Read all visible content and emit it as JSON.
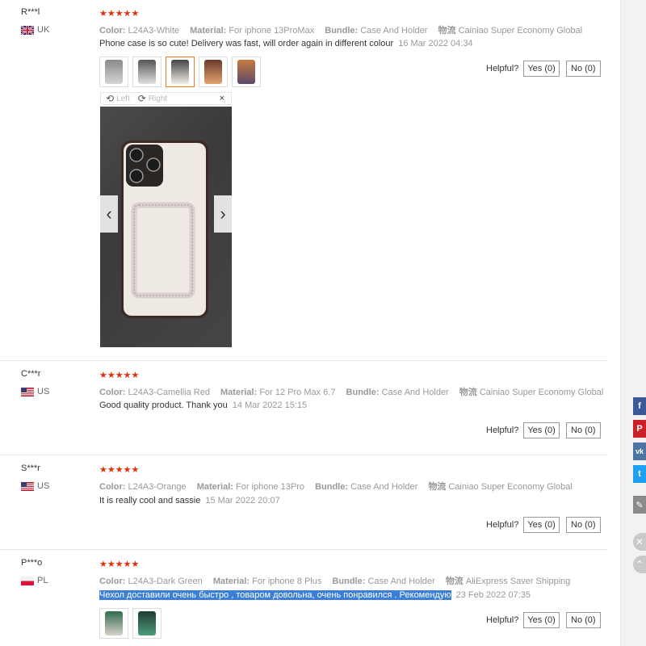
{
  "helpful_label": "Helpful?",
  "yes_label": "Yes (0)",
  "no_label": "No (0)",
  "labels": {
    "color": "Color:",
    "material": "Material:",
    "bundle": "Bundle:",
    "ship": "物流"
  },
  "viewer": {
    "left": "Left",
    "right": "Right",
    "close": "×"
  },
  "reviews": [
    {
      "user": "R***l",
      "country": "UK",
      "color": "L24A3-White",
      "material": "For iphone 13ProMax",
      "bundle": "Case And Holder",
      "ship": "Cainiao Super Economy Global",
      "text": "Phone case is so cute! Delivery was fast, will order again in different colour",
      "date": "16 Mar 2022 04:34"
    },
    {
      "user": "C***r",
      "country": "US",
      "color": "L24A3-Camellia Red",
      "material": "For 12 Pro Max 6.7",
      "bundle": "Case And Holder",
      "ship": "Cainiao Super Economy Global",
      "text": "Good quality product. Thank you",
      "date": "14 Mar 2022 15:15"
    },
    {
      "user": "S***r",
      "country": "US",
      "color": "L24A3-Orange",
      "material": "For iphone 13Pro",
      "bundle": "Case And Holder",
      "ship": "Cainiao Super Economy Global",
      "text": "It is really cool and sassie",
      "date": "15 Mar 2022 20:07"
    },
    {
      "user": "P***o",
      "country": "PL",
      "color": "L24A3-Dark Green",
      "material": "For iphone 8 Plus",
      "bundle": "Case And Holder",
      "ship": "AliExpress Saver Shipping",
      "text": "Чехол доставили очень быстро , товаром довольна, очень понравился . Рекомендую",
      "date": "23 Feb 2022 07:35"
    }
  ],
  "share": {
    "facebook": "f",
    "pinterest": "P",
    "vk": "vk",
    "twitter": "t"
  },
  "colors": {
    "star": "#e62e04",
    "active_thumb": "#f57b22",
    "highlight": "#3a7fd5",
    "facebook": "#3b5998",
    "pinterest": "#cb2027",
    "vk": "#4c75a3",
    "twitter": "#1da1f2"
  }
}
